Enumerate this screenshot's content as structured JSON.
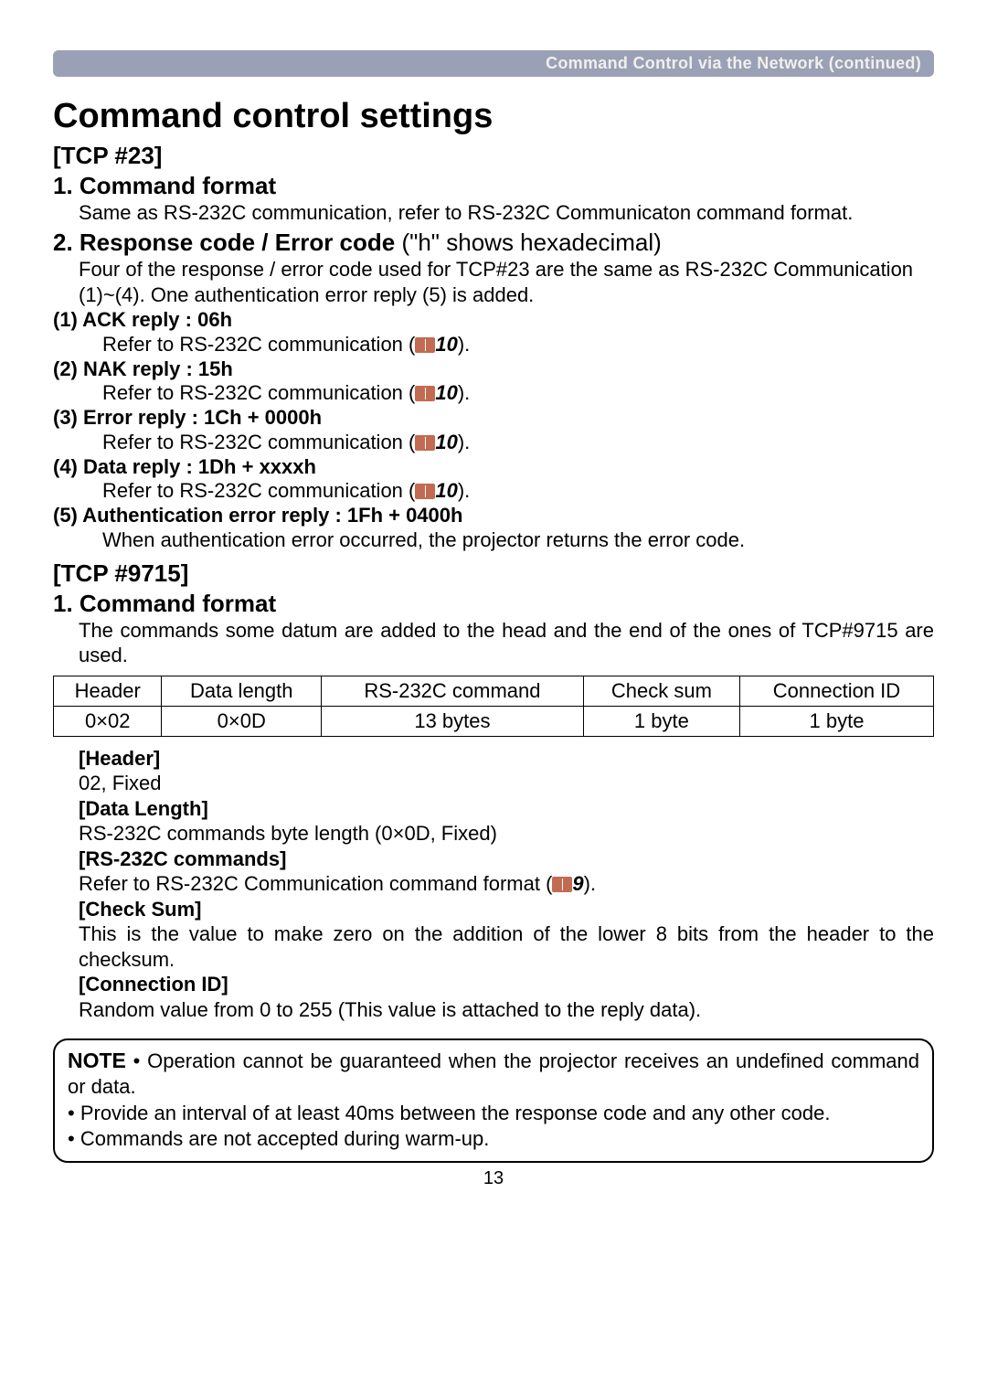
{
  "header_bar": {
    "text": "Command Control via the Network (continued)"
  },
  "title": "Command control settings",
  "tcp23": {
    "heading": "[TCP #23]",
    "s1": {
      "heading": "1. Command format",
      "body": "Same as RS-232C communication, refer to RS-232C Communicaton command format."
    },
    "s2": {
      "heading_bold": "2. Response code / Error code",
      "heading_rest": " (\"h\" shows hexadecimal)",
      "body1": "Four of the response / error code used for TCP#23 are the same as RS-232C Communication (1)~(4). One authentication error reply (5) is added.",
      "items": [
        {
          "title": "(1) ACK reply : 06h",
          "refer": "Refer to RS-232C communication (",
          "page": "10",
          "close": ")."
        },
        {
          "title": "(2) NAK reply : 15h",
          "refer": "Refer to RS-232C communication (",
          "page": "10",
          "close": ")."
        },
        {
          "title": "(3) Error reply : 1Ch + 0000h",
          "refer": "Refer to RS-232C communication (",
          "page": "10",
          "close": ")."
        },
        {
          "title": "(4) Data reply : 1Dh + xxxxh",
          "refer": "Refer to RS-232C communication (",
          "page": "10",
          "close": ")."
        },
        {
          "title": "(5) Authentication error reply : 1Fh + 0400h",
          "refer": "When authentication error occurred, the projector returns the error code."
        }
      ]
    }
  },
  "tcp9715": {
    "heading": "[TCP #9715]",
    "s1": {
      "heading": "1. Command format",
      "body": "The commands some datum are added to the head and the end of the ones of TCP#9715 are used."
    },
    "table": {
      "headers": [
        "Header",
        "Data length",
        "RS-232C command",
        "Check sum",
        "Connection ID"
      ],
      "row": [
        "0×02",
        "0×0D",
        "13 bytes",
        "1 byte",
        "1 byte"
      ]
    },
    "defs": {
      "header": {
        "label": "[Header]",
        "text": "02, Fixed"
      },
      "datalen": {
        "label": "[Data Length]",
        "text": "RS-232C commands byte length (0×0D, Fixed)"
      },
      "rs232c": {
        "label": "[RS-232C commands]",
        "text_pre": "Refer to RS-232C Communication command format (",
        "page": "9",
        "text_post": ")."
      },
      "checksum": {
        "label": "[Check Sum]",
        "text": "This is the value to make zero on the addition of the lower 8 bits from the header to the checksum."
      },
      "connid": {
        "label": "[Connection ID]",
        "text": "Random value from 0 to 255 (This value is attached to the reply data)."
      }
    }
  },
  "note": {
    "label": "NOTE",
    "line1": " • Operation cannot be guaranteed when the projector receives an undefined command or data.",
    "line2": "• Provide an interval of at least 40ms between the response code and any other code.",
    "line3": " • Commands are not accepted during warm-up."
  },
  "page_number": "13"
}
